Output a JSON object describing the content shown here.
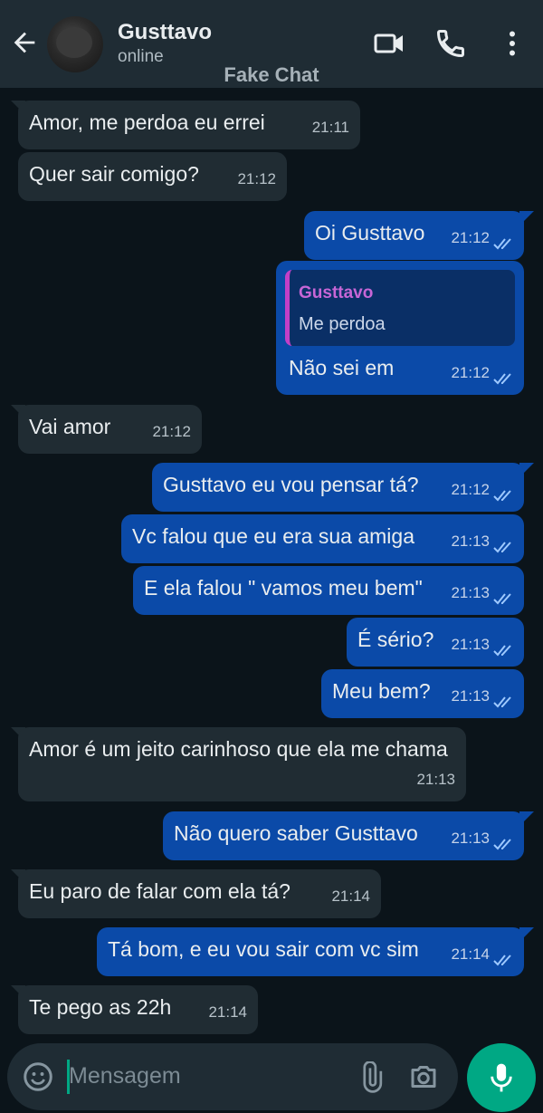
{
  "header": {
    "contact_name": "Gusttavo",
    "status": "online",
    "banner": "Fake Chat"
  },
  "icons": {
    "back": "arrow-left-icon",
    "video": "video-camera-icon",
    "call": "phone-icon",
    "menu": "more-vertical-icon",
    "emoji": "emoji-icon",
    "attach": "paperclip-icon",
    "camera": "camera-icon",
    "mic": "microphone-icon"
  },
  "colors": {
    "incoming_bubble": "#202c33",
    "outgoing_bubble": "#0b4aa8",
    "accent": "#00a884",
    "quote_bar": "#c33fc7"
  },
  "messages": [
    {
      "dir": "in",
      "text": "Amor, me perdoa eu errei",
      "time": "21:11"
    },
    {
      "dir": "in",
      "text": "Quer sair comigo?",
      "time": "21:12"
    },
    {
      "dir": "out",
      "text": "Oi Gusttavo",
      "time": "21:12"
    },
    {
      "dir": "out",
      "text": "Não sei em",
      "time": "21:12",
      "quote": {
        "name": "Gusttavo",
        "text": "Me perdoa"
      }
    },
    {
      "dir": "in",
      "text": "Vai amor",
      "time": "21:12"
    },
    {
      "dir": "out",
      "text": "Gusttavo eu vou pensar tá?",
      "time": "21:12"
    },
    {
      "dir": "out",
      "text": "Vc falou que eu era sua amiga",
      "time": "21:13"
    },
    {
      "dir": "out",
      "text": "E ela falou \" vamos meu bem\"",
      "time": "21:13"
    },
    {
      "dir": "out",
      "text": "É sério?",
      "time": "21:13"
    },
    {
      "dir": "out",
      "text": "Meu bem?",
      "time": "21:13"
    },
    {
      "dir": "in",
      "text": "Amor é um jeito carinhoso que ela me chama",
      "time": "21:13"
    },
    {
      "dir": "out",
      "text": "Não quero saber Gusttavo",
      "time": "21:13"
    },
    {
      "dir": "in",
      "text": "Eu paro de falar com ela tá?",
      "time": "21:14"
    },
    {
      "dir": "out",
      "text": "Tá bom, e eu vou sair com vc sim",
      "time": "21:14"
    },
    {
      "dir": "in",
      "text": "Te pego as 22h",
      "time": "21:14"
    }
  ],
  "composer": {
    "placeholder": "Mensagem"
  }
}
